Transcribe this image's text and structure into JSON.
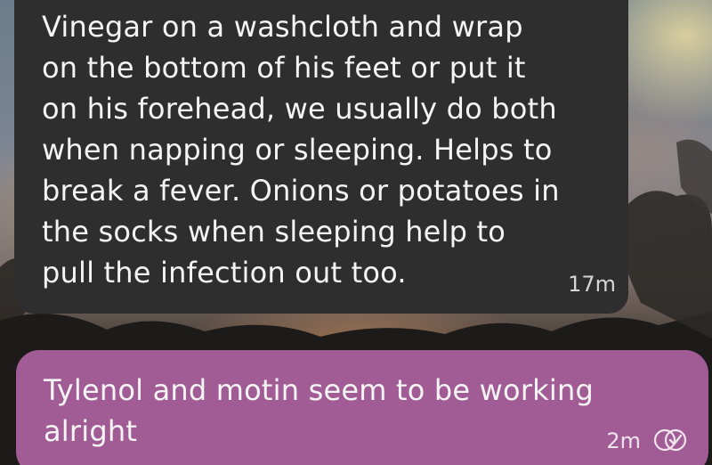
{
  "messages": [
    {
      "direction": "received",
      "text": "Vinegar on a washcloth and wrap\non the bottom of his feet or put it\non his forehead, we usually do both\nwhen napping or sleeping. Helps to\nbreak a fever. Onions or potatoes in\nthe socks when sleeping help to\npull the infection out too.",
      "time": "17m"
    },
    {
      "direction": "sent",
      "text": "Tylenol and motin seem to be working\nalright",
      "time": "2m",
      "status_icon": "read-receipt-icon"
    }
  ],
  "colors": {
    "received_bubble": "#2e2e2e",
    "sent_bubble": "#a25c95",
    "text": "#f4f4f4"
  }
}
